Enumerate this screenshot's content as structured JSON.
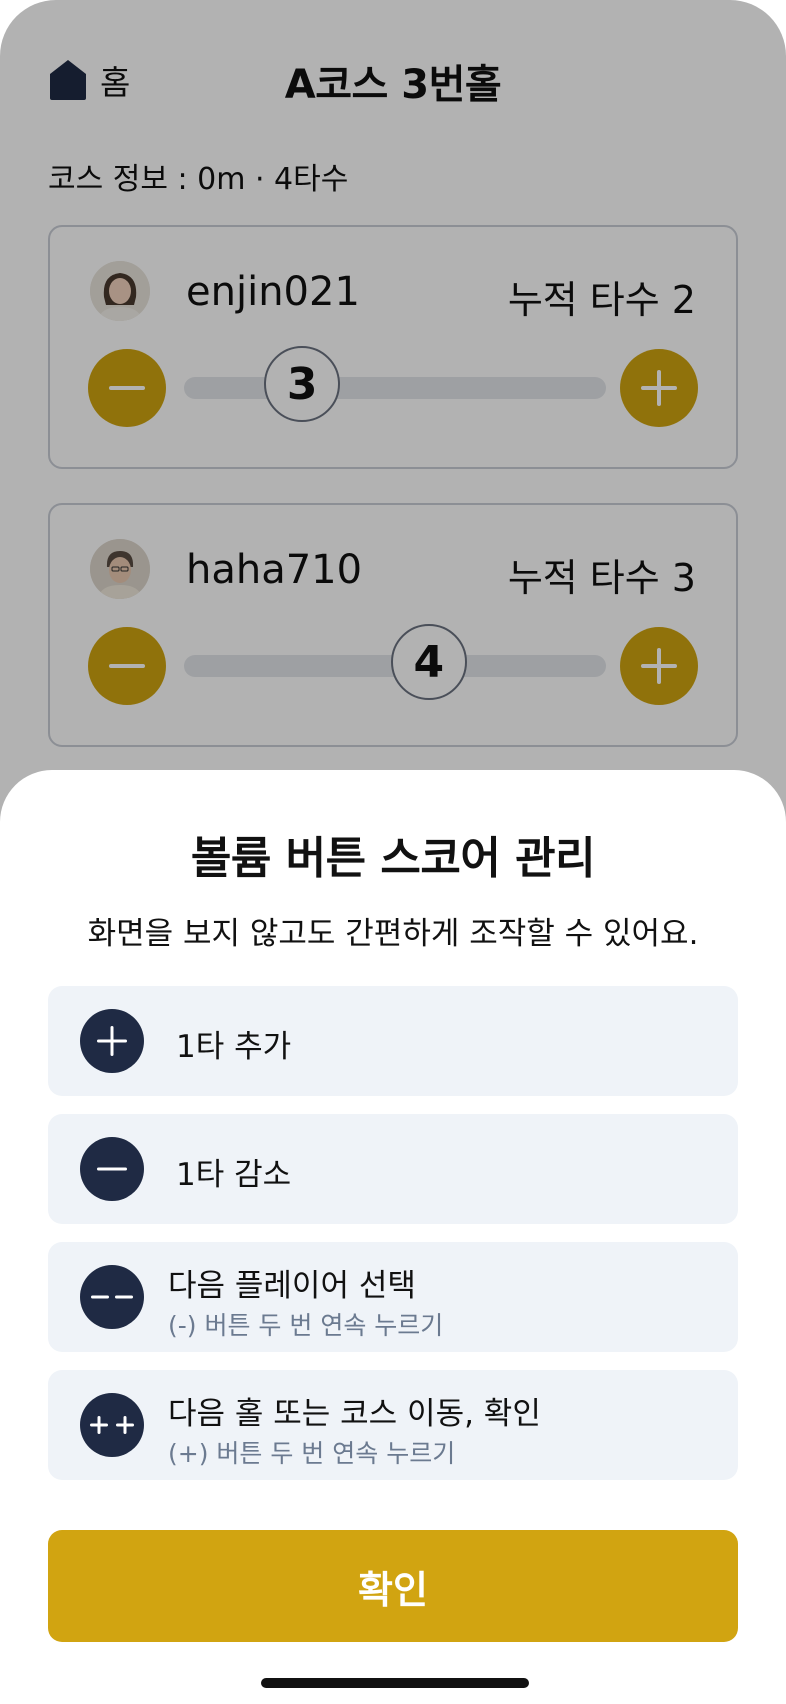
{
  "header": {
    "home_label": "홈",
    "title": "A코스 3번홀"
  },
  "course_info": "코스 정보 : 0m · 4타수",
  "players": [
    {
      "username": "enjin021",
      "total": "누적 타수 2",
      "score": "3",
      "slider_fraction": 0.28
    },
    {
      "username": "haha710",
      "total": "누적 타수 3",
      "score": "4",
      "slider_fraction": 0.58
    }
  ],
  "sheet": {
    "title": "볼륨 버튼 스코어 관리",
    "subtitle": "화면을 보지 않고도 간편하게 조작할 수 있어요.",
    "options": [
      {
        "icon": "plus-icon",
        "label": "1타 추가"
      },
      {
        "icon": "minus-icon",
        "label": "1타 감소"
      },
      {
        "icon": "double-minus-icon",
        "label": "다음 플레이어 선택",
        "hint": "(-) 버튼 두 번 연속 누르기"
      },
      {
        "icon": "double-plus-icon",
        "label": "다음 홀 또는 코스 이동, 확인",
        "hint": "(+) 버튼 두 번 연속 누르기"
      }
    ],
    "confirm_label": "확인"
  },
  "colors": {
    "accent": "#cfa411",
    "icon_circle": "#1f2a44",
    "option_bg": "#eff3f8",
    "hint_text": "#6b7a90"
  }
}
